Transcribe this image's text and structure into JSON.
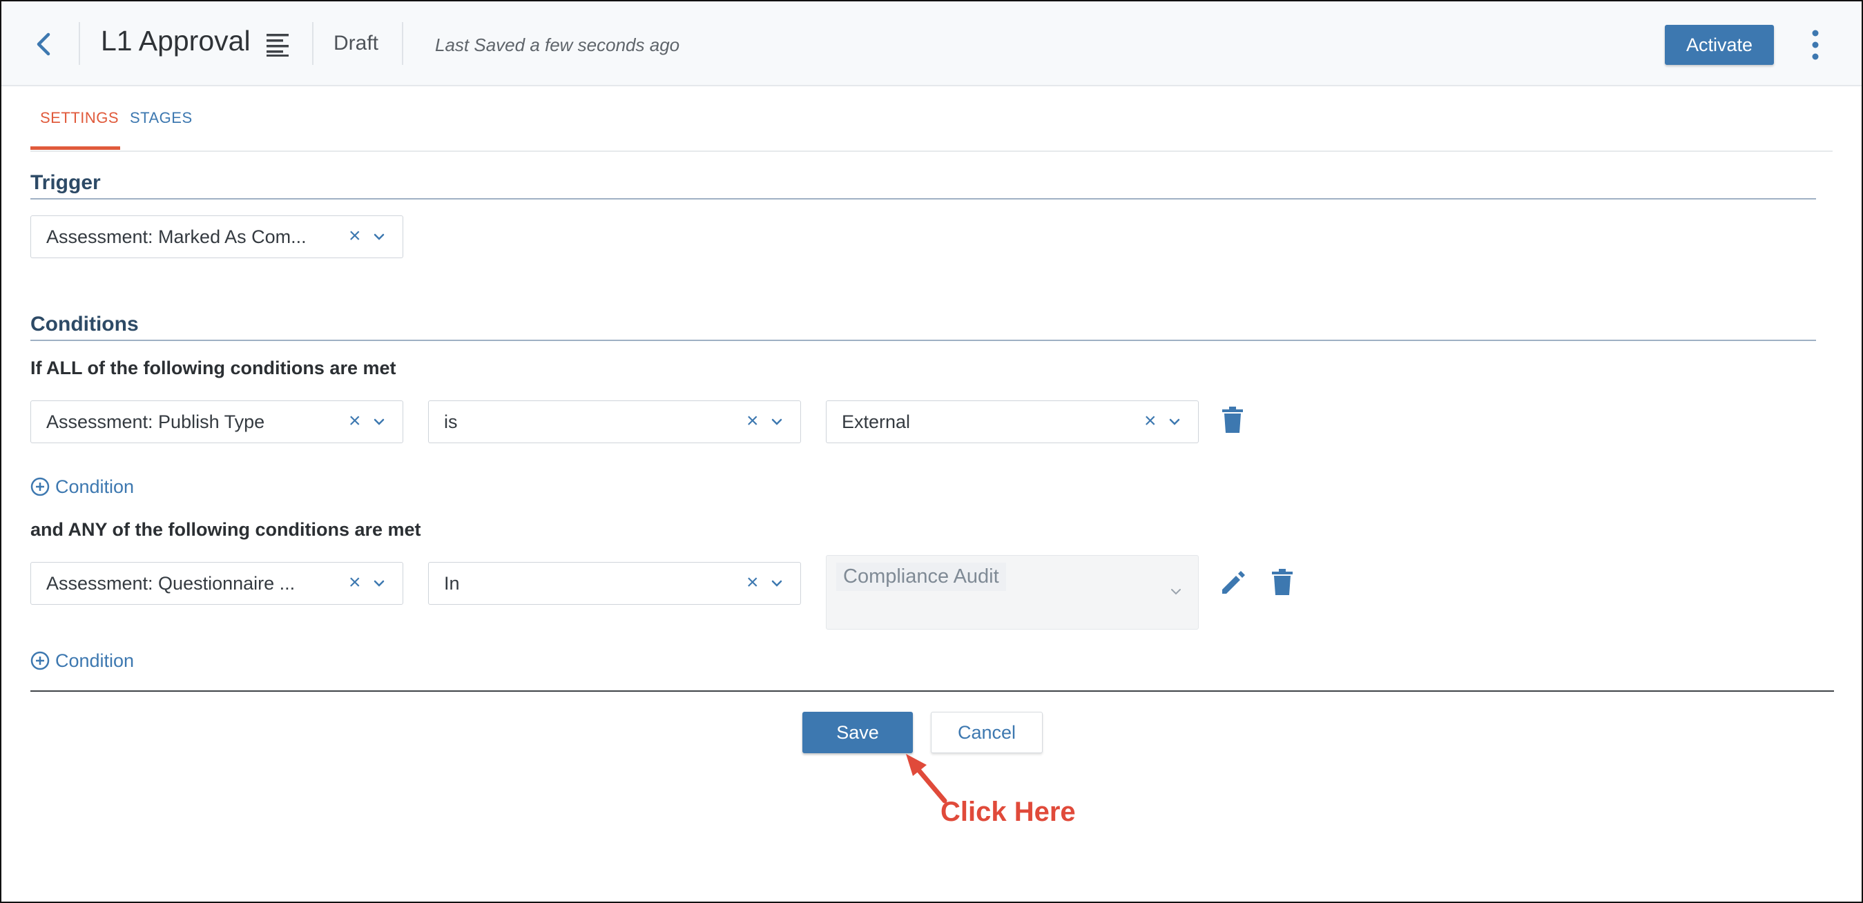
{
  "header": {
    "title": "L1 Approval",
    "status": "Draft",
    "last_saved": "Last Saved a few seconds ago",
    "activate_label": "Activate"
  },
  "tabs": [
    {
      "label": "SETTINGS",
      "active": true
    },
    {
      "label": "STAGES",
      "active": false
    }
  ],
  "trigger": {
    "title": "Trigger",
    "value": "Assessment: Marked As Com..."
  },
  "conditions": {
    "title": "Conditions",
    "all_label": "If ALL of the following conditions are met",
    "all_rows": [
      {
        "field": "Assessment: Publish Type",
        "operator": "is",
        "value": "External"
      }
    ],
    "any_label": "and ANY of the following conditions are met",
    "any_rows": [
      {
        "field": "Assessment: Questionnaire ...",
        "operator": "In",
        "values": [
          "Compliance Audit"
        ]
      }
    ],
    "add_condition_label": "Condition"
  },
  "footer": {
    "save_label": "Save",
    "cancel_label": "Cancel"
  },
  "annotation": {
    "text": "Click Here"
  },
  "colors": {
    "primary": "#3d78b0",
    "accent": "#e05a3b",
    "annotation": "#e04a3a"
  }
}
